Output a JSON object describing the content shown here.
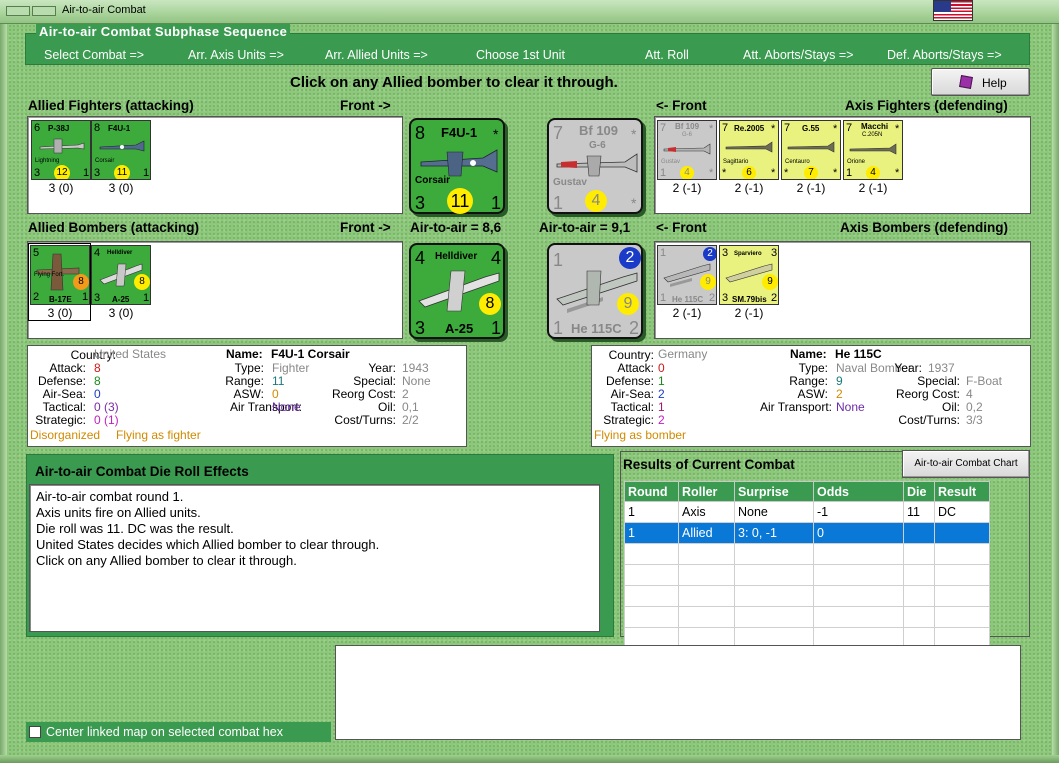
{
  "window": {
    "title": "Air-to-air Combat"
  },
  "subphase": {
    "legend": "Air-to-air Combat Subphase Sequence",
    "steps": [
      "Select Combat =>",
      "Arr. Axis Units =>",
      "Arr. Allied Units =>",
      "Choose 1st Unit",
      "Att. Roll",
      "Att. Aborts/Stays =>",
      "Def. Aborts/Stays =>"
    ]
  },
  "instruction": "Click on any Allied bomber to clear it through.",
  "help_label": "Help",
  "headers": {
    "allied_fighters": "Allied Fighters (attacking)",
    "front_right": "Front ->",
    "front_left": "<- Front",
    "axis_fighters": "Axis Fighters (defending)",
    "allied_bombers": "Allied Bombers (attacking)",
    "front_right2": "Front ->",
    "ata_allied": "Air-to-air = 8,6",
    "ata_axis": "Air-to-air = 9,1",
    "front_left2": "<- Front",
    "axis_bombers": "Axis Bombers (defending)"
  },
  "allied_fighters": [
    {
      "top_num": "6",
      "name": "P-38J",
      "sub": "Lightning",
      "left": "3",
      "circle": "12",
      "right": "1",
      "caption": "3 (0)"
    },
    {
      "top_num": "8",
      "name": "F4U-1",
      "sub": "Corsair",
      "left": "3",
      "circle": "11",
      "right": "1",
      "caption": "3 (0)"
    }
  ],
  "axis_fighters": [
    {
      "top_num": "7",
      "name": "Bf 109",
      "name2": "G-6",
      "sub": "Gustav",
      "left": "1",
      "circle": "4",
      "right": "*",
      "star": "*",
      "caption": "2 (-1)"
    },
    {
      "top_num": "7",
      "name": "Re.2005",
      "sub": "Sagittario",
      "left": "*",
      "circle": "6",
      "right": "*",
      "star": "*",
      "caption": "2 (-1)"
    },
    {
      "top_num": "7",
      "name": "G.55",
      "sub": "Centauro",
      "left": "*",
      "circle": "7",
      "right": "*",
      "star": "*",
      "caption": "2 (-1)"
    },
    {
      "top_num": "7",
      "name": "Macchi",
      "name2": "C.205N",
      "sub": "Orione",
      "left": "1",
      "circle": "4",
      "right": "*",
      "star": "*",
      "caption": "2 (-1)"
    }
  ],
  "allied_bombers": [
    {
      "top_num": "5",
      "name": "B-17E",
      "sub": "Flying Fort.",
      "left": "2",
      "circle": "8",
      "right": "1",
      "caption": "3 (0)"
    },
    {
      "top_num": "4",
      "name": "A-25",
      "sub": "Helldiver",
      "left": "3",
      "circle": "8",
      "right": "1",
      "caption": "3 (0)"
    }
  ],
  "axis_bombers": [
    {
      "top_num": "1",
      "name": "He 115C",
      "left": "1",
      "circle": "9",
      "right": "2",
      "blue": "2",
      "caption": "2 (-1)"
    },
    {
      "top_num": "3",
      "name": "SM.79bis",
      "sub": "Sparviero",
      "left": "3",
      "circle": "9",
      "right": "2",
      "caption": "2 (-1)"
    }
  ],
  "big_allied_fighter": {
    "top_num": "8",
    "name": "F4U-1",
    "star": "*",
    "sub": "Corsair",
    "left": "3",
    "circle": "11",
    "right": "1"
  },
  "big_axis_fighter": {
    "top_num": "7",
    "name": "Bf 109",
    "name2": "G-6",
    "star": "*",
    "sub": "Gustav",
    "left": "1",
    "circle": "4",
    "right": "*"
  },
  "big_allied_bomber": {
    "top_num": "4",
    "name": "Helldiver",
    "top_right": "4",
    "sub": "A-25",
    "left": "3",
    "circle": "8",
    "right": "1"
  },
  "big_axis_bomber": {
    "top_num": "1",
    "blue": "2",
    "name": "He 115C",
    "left": "1",
    "circle": "9",
    "right": "2"
  },
  "allied_info": {
    "country_label": "Country:",
    "country": "United States",
    "attack_label": "Attack:",
    "attack": "8",
    "defense_label": "Defense:",
    "defense": "8",
    "airsea_label": "Air-Sea:",
    "airsea": "0",
    "tactical_label": "Tactical:",
    "tactical": "0 (3)",
    "strategic_label": "Strategic:",
    "strategic": "0 (1)",
    "status1": "Disorganized",
    "status2": "Flying as fighter",
    "name_label": "Name:",
    "name": "F4U-1 Corsair",
    "type_label": "Type:",
    "type": "Fighter",
    "range_label": "Range:",
    "range": "11",
    "asw_label": "ASW:",
    "asw": "0",
    "airtransport_label": "Air Transport:",
    "airtransport": "None",
    "year_label": "Year:",
    "year": "1943",
    "special_label": "Special:",
    "special": "None",
    "reorg_label": "Reorg Cost:",
    "reorg": "2",
    "oil_label": "Oil:",
    "oil": "0,1",
    "cost_label": "Cost/Turns:",
    "cost": "2/2"
  },
  "axis_info": {
    "country_label": "Country:",
    "country": "Germany",
    "attack_label": "Attack:",
    "attack": "0",
    "defense_label": "Defense:",
    "defense": "1",
    "airsea_label": "Air-Sea:",
    "airsea": "2",
    "tactical_label": "Tactical:",
    "tactical": "1",
    "strategic_label": "Strategic:",
    "strategic": "2",
    "status2": "Flying as bomber",
    "name_label": "Name:",
    "name": "He 115C",
    "type_label": "Type:",
    "type": "Naval Bomber",
    "range_label": "Range:",
    "range": "9",
    "asw_label": "ASW:",
    "asw": "2",
    "airtransport_label": "Air Transport:",
    "airtransport": "None",
    "year_label": "Year:",
    "year": "1937",
    "special_label": "Special:",
    "special": "F-Boat",
    "reorg_label": "Reorg Cost:",
    "reorg": "4",
    "oil_label": "Oil:",
    "oil": "0,2",
    "cost_label": "Cost/Turns:",
    "cost": "3/3"
  },
  "die_effects": {
    "title": "Air-to-air Combat Die Roll Effects",
    "lines": [
      "Air-to-air combat round 1.",
      "Axis units fire on Allied units.",
      "Die roll was 11.  DC was the result.",
      "United States decides which Allied bomber to clear through.",
      "Click on any Allied bomber to clear it through."
    ]
  },
  "results": {
    "title": "Results of Current Combat",
    "chart_button": "Air-to-air Combat Chart",
    "columns": [
      "Round",
      "Roller",
      "Surprise",
      "Odds",
      "Die",
      "Result"
    ],
    "rows": [
      [
        "1",
        "Axis",
        "None",
        "-1",
        "11",
        "DC"
      ],
      [
        "1",
        "Allied",
        "3: 0, -1",
        "0",
        "",
        ""
      ]
    ]
  },
  "center_map_label": "Center linked map on selected combat hex",
  "colors": {
    "green_panel": "#3a9a50",
    "counter_green": "#3cab3c",
    "counter_grey": "#c9c9c9",
    "counter_yellow": "#e9f27e",
    "selected_row": "#0a78d7",
    "attack_red": "#d01818",
    "defense_green": "#1a8a1a",
    "airsea_blue": "#1a3ac8",
    "strategic_purple": "#c020c0",
    "status_orange": "#d08a00"
  }
}
